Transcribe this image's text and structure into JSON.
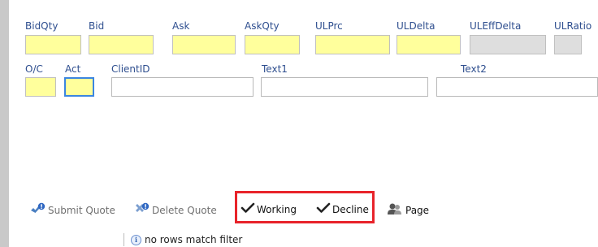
{
  "fields_row1": [
    {
      "label": "BidQty",
      "value": ""
    },
    {
      "label": "Bid",
      "value": ""
    },
    {
      "label": "Ask",
      "value": ""
    },
    {
      "label": "AskQty",
      "value": ""
    },
    {
      "label": "ULPrc",
      "value": ""
    },
    {
      "label": "ULDelta",
      "value": ""
    },
    {
      "label": "ULEffDelta",
      "value": ""
    },
    {
      "label": "ULRatio",
      "value": ""
    }
  ],
  "fields_row2": [
    {
      "label": "O/C",
      "value": ""
    },
    {
      "label": "Act",
      "value": ""
    },
    {
      "label": "ClientID",
      "value": ""
    },
    {
      "label": "Text1",
      "value": ""
    },
    {
      "label": "Text2",
      "value": ""
    }
  ],
  "toolbar": {
    "submit_quote": "Submit Quote",
    "delete_quote": "Delete Quote",
    "working": "Working",
    "decline": "Decline",
    "page": "Page"
  },
  "status": {
    "message": "no rows match filter"
  },
  "colors": {
    "editable_field": "#ffff9c",
    "disabled_field": "#dedede",
    "label_text": "#2f4f8f",
    "highlight_border": "#e8232a",
    "focus_border": "#3b86e0"
  }
}
